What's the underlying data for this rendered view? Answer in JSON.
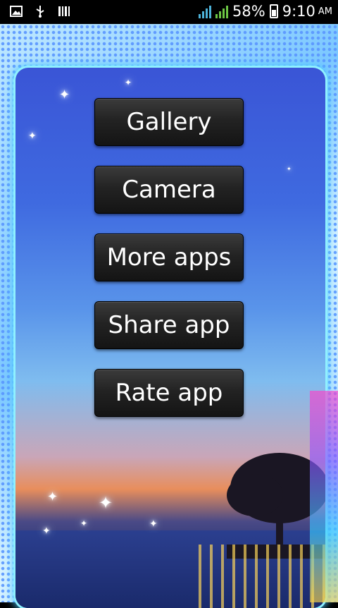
{
  "status_bar": {
    "battery": "58%",
    "time": "9:10",
    "ampm": "AM",
    "icons": [
      "image-notification-icon",
      "usb-icon",
      "barcode-icon",
      "signal-bars-icon",
      "signal-bars-icon",
      "battery-icon"
    ]
  },
  "menu": {
    "buttons": [
      {
        "label": "Gallery"
      },
      {
        "label": "Camera"
      },
      {
        "label": "More apps"
      },
      {
        "label": "Share app"
      },
      {
        "label": "Rate app"
      }
    ]
  },
  "colors": {
    "button_bg": "#1e1e1e",
    "frame_glow": "#8ff0ff",
    "sky_top": "#3a55d6"
  }
}
